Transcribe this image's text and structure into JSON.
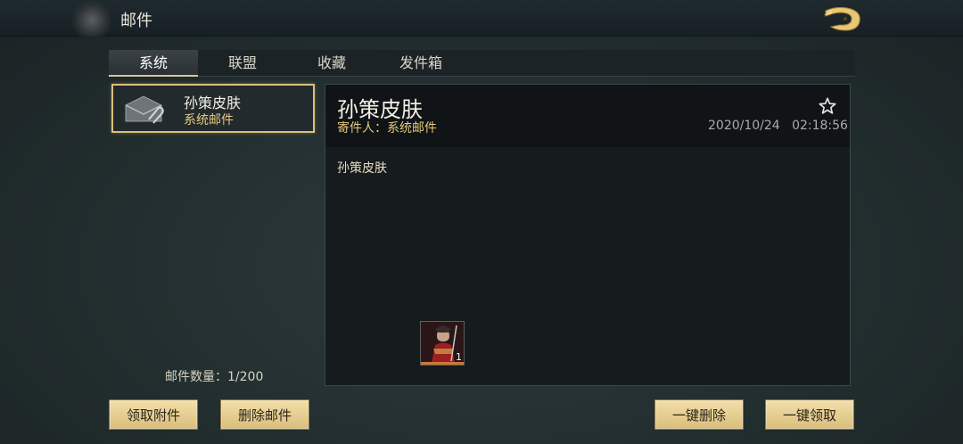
{
  "header": {
    "title": "邮件"
  },
  "tabs": [
    {
      "label": "系统",
      "active": true
    },
    {
      "label": "联盟",
      "active": false
    },
    {
      "label": "收藏",
      "active": false
    },
    {
      "label": "发件箱",
      "active": false
    }
  ],
  "mail_list": {
    "items": [
      {
        "title": "孙策皮肤",
        "sender": "系统邮件",
        "icon": "mail-attachment-icon",
        "selected": true
      }
    ],
    "count_text": "邮件数量：1/200"
  },
  "detail": {
    "title": "孙策皮肤",
    "sender_line": "寄件人：系统邮件",
    "date": "2020/10/24",
    "time": "02:18:56",
    "body": "孙策皮肤",
    "attachment": {
      "icon": "skin-item-icon",
      "count": "1"
    }
  },
  "buttons": {
    "claim_attachment": "领取附件",
    "delete_mail": "删除邮件",
    "delete_all": "一键删除",
    "claim_all": "一键领取"
  },
  "colors": {
    "accent_gold": "#d9c07d",
    "sender_gold": "#e6c97e",
    "button_gold": "#e8cf92"
  }
}
